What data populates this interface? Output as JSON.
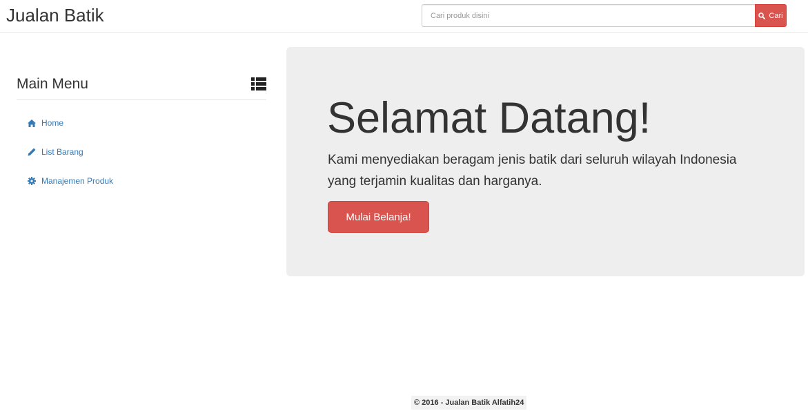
{
  "navbar": {
    "brand": "Jualan Batik",
    "search": {
      "placeholder": "Cari produk disini",
      "button_label": "Cari",
      "button_icon": "search-icon"
    }
  },
  "sidebar": {
    "title": "Main Menu",
    "title_icon": "list-icon",
    "items": [
      {
        "label": "Home",
        "icon": "home-icon"
      },
      {
        "label": "List Barang",
        "icon": "pencil-icon"
      },
      {
        "label": "Manajemen Produk",
        "icon": "gear-icon"
      }
    ]
  },
  "jumbotron": {
    "title": "Selamat Datang!",
    "text": "Kami menyediakan beragam jenis batik dari seluruh wilayah Indonesia yang terjamin kualitas dan harganya.",
    "button_label": "Mulai Belanja!"
  },
  "footer": {
    "text": "© 2016 - Jualan Batik Alfatih24"
  },
  "colors": {
    "accent": "#d9534f",
    "link": "#337ab7",
    "jumbotron_bg": "#eeeeee"
  }
}
